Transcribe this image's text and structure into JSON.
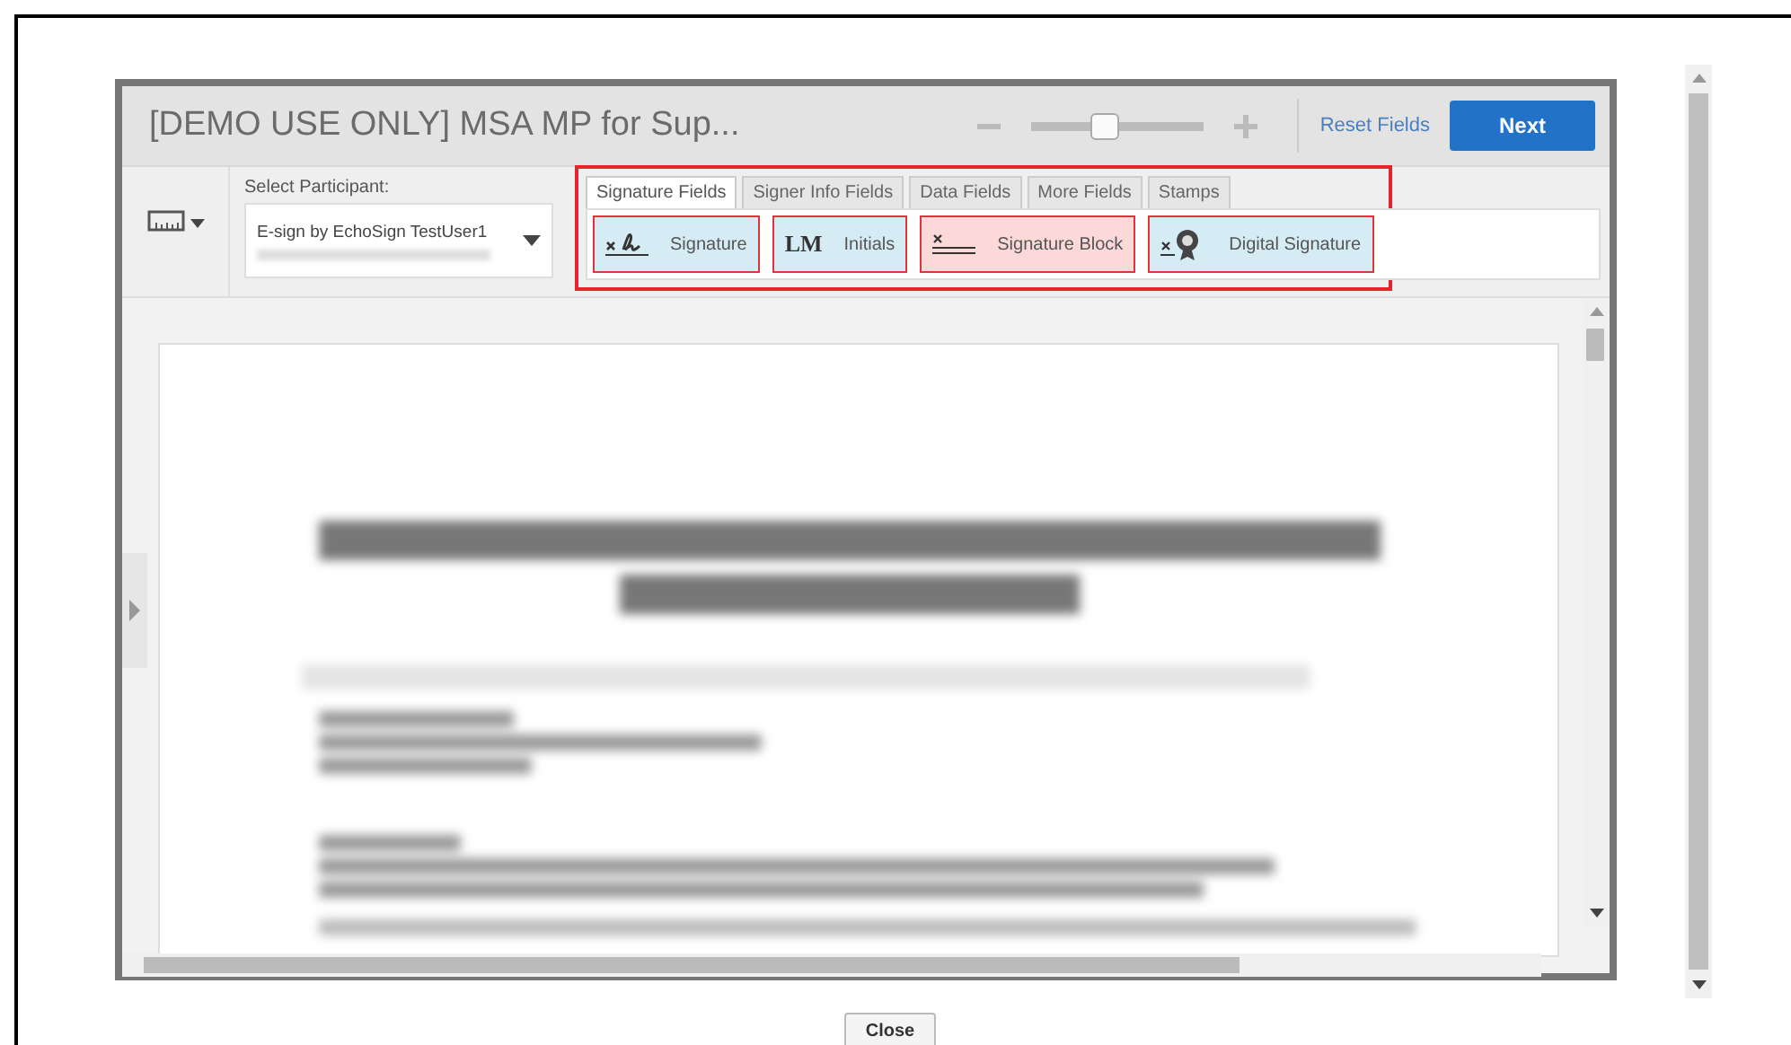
{
  "dialog": {
    "title": "[DEMO USE ONLY] MSA MP for Sup...",
    "zoom": {
      "level": 0.42
    },
    "reset_link": "Reset Fields",
    "next_button": "Next"
  },
  "toolbar": {
    "participant_label": "Select Participant:",
    "participant_value": "E-sign by EchoSign TestUser1",
    "tabs": [
      {
        "label": "Signature Fields",
        "selected": true
      },
      {
        "label": "Signer Info Fields",
        "selected": false
      },
      {
        "label": "Data Fields",
        "selected": false
      },
      {
        "label": "More Fields",
        "selected": false
      },
      {
        "label": "Stamps",
        "selected": false
      }
    ],
    "fields": [
      {
        "kind": "signature",
        "label": "Signature",
        "color": "#d6ecf5"
      },
      {
        "kind": "initials",
        "label": "Initials",
        "icon_text": "LM",
        "color": "#d6ecf5"
      },
      {
        "kind": "block",
        "label": "Signature Block",
        "color": "#fbd9d9"
      },
      {
        "kind": "digital",
        "label": "Digital Signature",
        "color": "#d6ecf5"
      }
    ]
  },
  "close_button": "Close"
}
